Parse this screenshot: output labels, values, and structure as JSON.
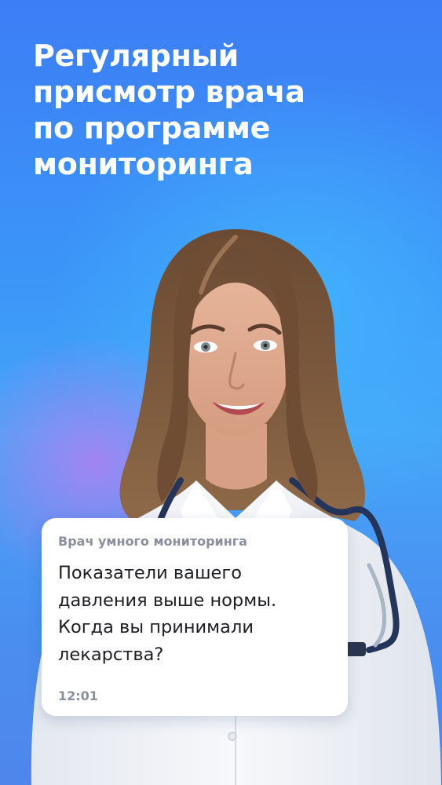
{
  "headline": {
    "lines": [
      "Регулярный",
      "присмотр врача",
      "по программе",
      "мониторинга"
    ]
  },
  "chat": {
    "sender": "Врач умного мониторинга",
    "message_lines": [
      "Показатели вашего",
      "давления выше нормы.",
      "Когда вы принимали",
      "лекарства?"
    ],
    "time": "12:01"
  },
  "colors": {
    "background_top": "#3d7ef6",
    "background_glow": "#45b9ff",
    "accent_purple": "#b280f0",
    "headline_text": "#ffffff",
    "card_background": "#ffffff",
    "secondary_text": "#8a8f9c"
  }
}
